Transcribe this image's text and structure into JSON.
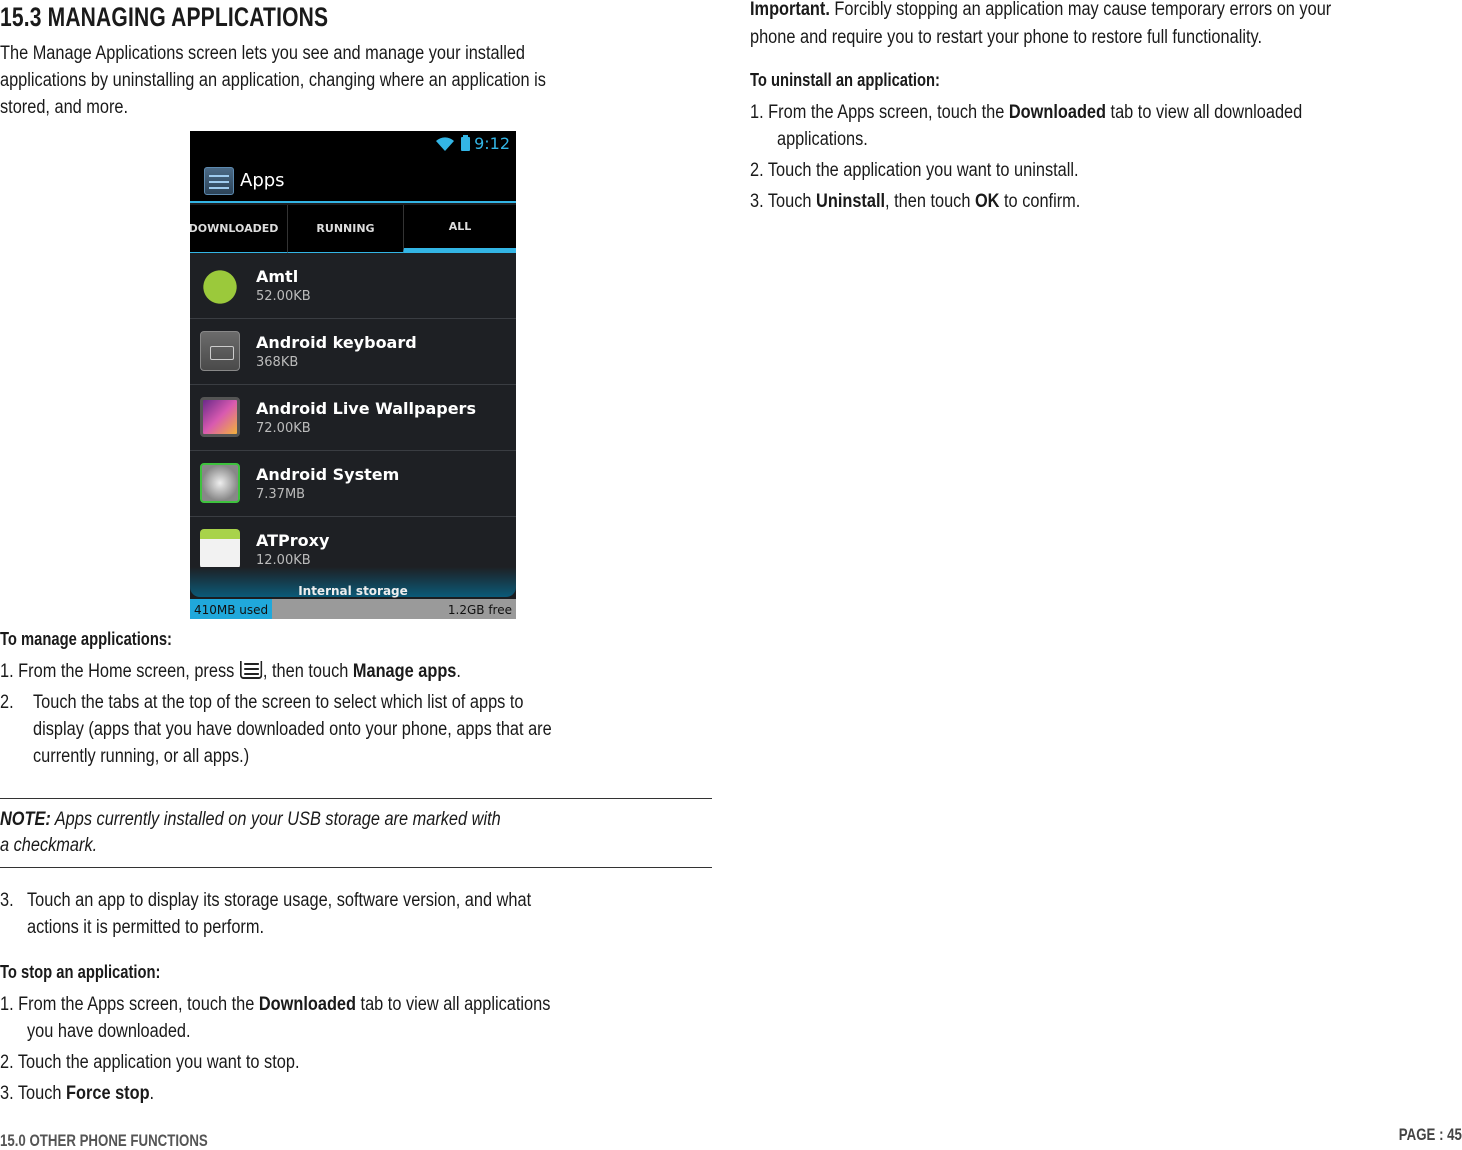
{
  "section_title": "15.3 MANAGING APPLICATIONS",
  "intro": [
    "The Manage Applications screen lets you see and manage your installed",
    "applications by uninstalling an application, changing where an application is",
    "stored, and more."
  ],
  "phone": {
    "status": {
      "time": "9:12",
      "icons": [
        "wifi-icon",
        "battery-charging-icon"
      ]
    },
    "actionbar_title": "Apps",
    "tabs": [
      "DOWNLOADED",
      "RUNNING",
      "ALL"
    ],
    "active_tab": "ALL",
    "apps": [
      {
        "name": "Amtl",
        "size": "52.00KB",
        "icon": "android-robot-icon"
      },
      {
        "name": "Android keyboard",
        "size": "368KB",
        "icon": "keyboard-icon"
      },
      {
        "name": "Android Live Wallpapers",
        "size": "72.00KB",
        "icon": "wallpaper-icon"
      },
      {
        "name": "Android System",
        "size": "7.37MB",
        "icon": "system-icon"
      },
      {
        "name": "ATProxy",
        "size": "12.00KB",
        "icon": "atproxy-icon"
      }
    ],
    "storage": {
      "label": "Internal storage",
      "used": "410MB used",
      "free": "1.2GB free",
      "used_fraction": 0.25
    }
  },
  "manage": {
    "heading": "To manage applications:",
    "step1": {
      "num": "1.",
      "pre": "From the Home screen, press",
      "post": ", then touch",
      "bold": "Manage apps",
      "end": "."
    },
    "step2": {
      "num": "2.",
      "lines": [
        "Touch the tabs at the top of the screen to select which list of apps to",
        "display (apps that you have downloaded onto your phone, apps that are",
        "currently running, or all apps.)"
      ]
    }
  },
  "note": {
    "label": "NOTE:",
    "line1": "Apps currently installed on your USB storage are marked with",
    "line2": "a checkmark."
  },
  "step3": {
    "num": "3.",
    "lines": [
      "Touch an app to display its storage usage, software version, and what",
      "actions it is permitted to perform."
    ]
  },
  "stop": {
    "heading": "To stop an application:",
    "s1": {
      "num": "1.",
      "pre": "From the Apps screen, touch the",
      "bold": "Downloaded",
      "post": "tab to view all applications",
      "line2": "you have downloaded."
    },
    "s2": {
      "num": "2.",
      "text": "Touch the application you want to stop."
    },
    "s3": {
      "num": "3.",
      "pre": "Touch",
      "bold": "Force stop",
      "end": "."
    }
  },
  "important": {
    "label": "Important.",
    "line1": "Forcibly stopping an application may cause temporary errors on your",
    "line2": "phone and require you to restart your phone to restore full functionality."
  },
  "uninstall": {
    "heading": "To uninstall an application:",
    "s1": {
      "num": "1.",
      "pre": "From the Apps screen, touch the",
      "bold": "Downloaded",
      "post": "tab to view all downloaded",
      "line2": "applications."
    },
    "s2": {
      "num": "2.",
      "text": "Touch the application you want to uninstall."
    },
    "s3": {
      "num": "3.",
      "pre": "Touch",
      "bold1": "Uninstall",
      "mid": ", then touch",
      "bold2": "OK",
      "end": "to confirm."
    }
  },
  "footer": {
    "chapter": "15.0 OTHER PHONE FUNCTIONS",
    "page": "PAGE : 45"
  }
}
